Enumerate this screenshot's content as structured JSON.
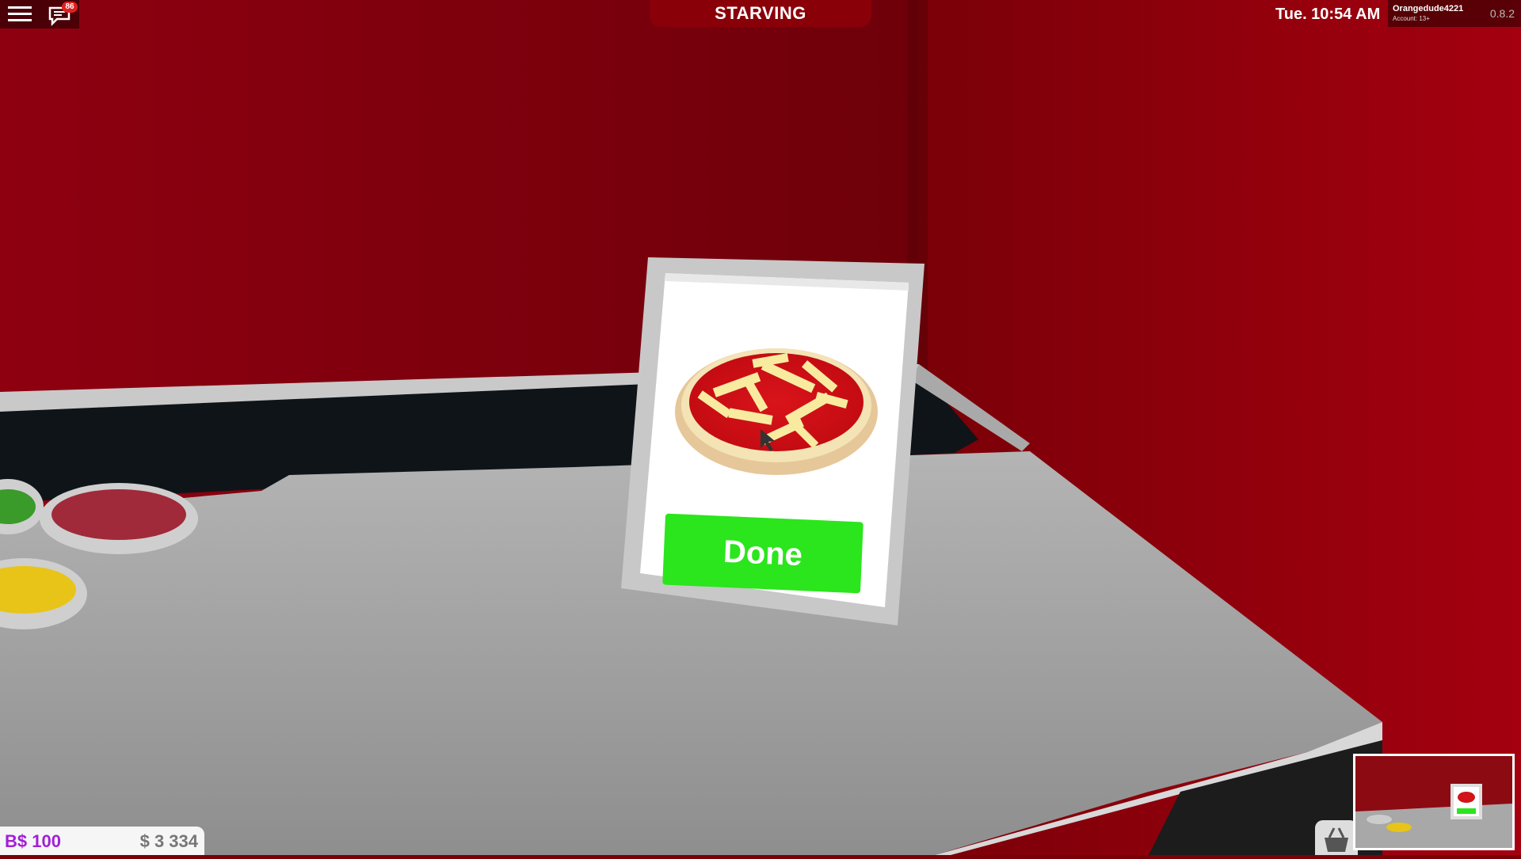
{
  "hud": {
    "status": "STARVING",
    "clock": "Tue. 10:54 AM",
    "username": "Orangedude4221",
    "account": "Account: 13+",
    "version": "0.8.2",
    "chat_badge": "86",
    "bucks": "B$ 100",
    "cash": "$ 3 334"
  },
  "sign": {
    "button_label": "Done"
  },
  "icons": {
    "menu": "hamburger-menu-icon",
    "chat": "chat-bubble-icon",
    "basket": "shopping-basket-icon"
  },
  "colors": {
    "wall": "#8a0008",
    "counter": "#9a9a9a",
    "done_green": "#2be51d",
    "bucks_purple": "#a21fd6"
  }
}
